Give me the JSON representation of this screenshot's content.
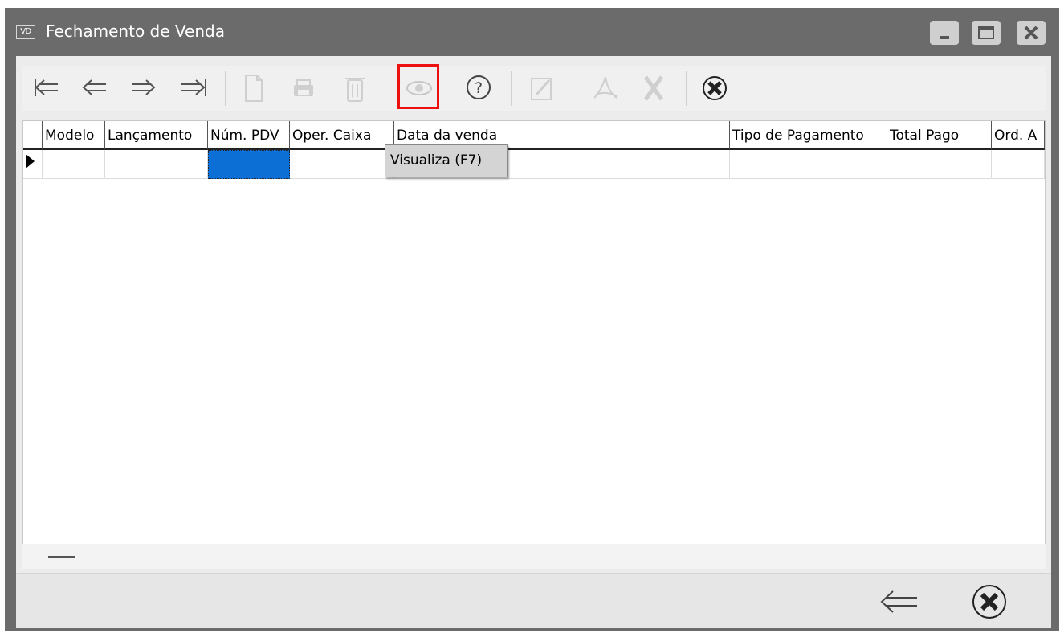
{
  "window": {
    "icon_text": "VD",
    "title": "Fechamento de Venda"
  },
  "toolbar": {
    "buttons": [
      {
        "icon": "first-record-icon",
        "enabled": true
      },
      {
        "icon": "previous-record-icon",
        "enabled": true
      },
      {
        "icon": "next-record-icon",
        "enabled": true
      },
      {
        "icon": "last-record-icon",
        "enabled": true
      },
      {
        "icon": "new-document-icon",
        "enabled": false
      },
      {
        "icon": "print-icon",
        "enabled": false
      },
      {
        "icon": "trash-icon",
        "enabled": false
      },
      {
        "icon": "eye-icon",
        "enabled": false,
        "highlighted": true
      },
      {
        "icon": "help-icon",
        "enabled": true
      },
      {
        "icon": "edit-icon",
        "enabled": false
      },
      {
        "icon": "pdf-icon",
        "enabled": false
      },
      {
        "icon": "excel-icon",
        "enabled": false
      },
      {
        "icon": "close-icon",
        "enabled": true
      }
    ],
    "highlight_color": "#ee1010"
  },
  "tooltip": "Visualiza (F7)",
  "grid": {
    "columns": [
      "Modelo",
      "Lançamento",
      "Núm. PDV",
      "Oper. Caixa",
      "Data da venda",
      "Tipo de Pagamento",
      "Total Pago",
      "Ord. A"
    ],
    "rows": [
      [
        "",
        "",
        "",
        "",
        "",
        "",
        "",
        ""
      ]
    ],
    "selected_color": "#0b6fd6"
  },
  "footer": {
    "buttons": [
      {
        "icon": "back-arrow-icon"
      },
      {
        "icon": "close-icon"
      }
    ]
  }
}
